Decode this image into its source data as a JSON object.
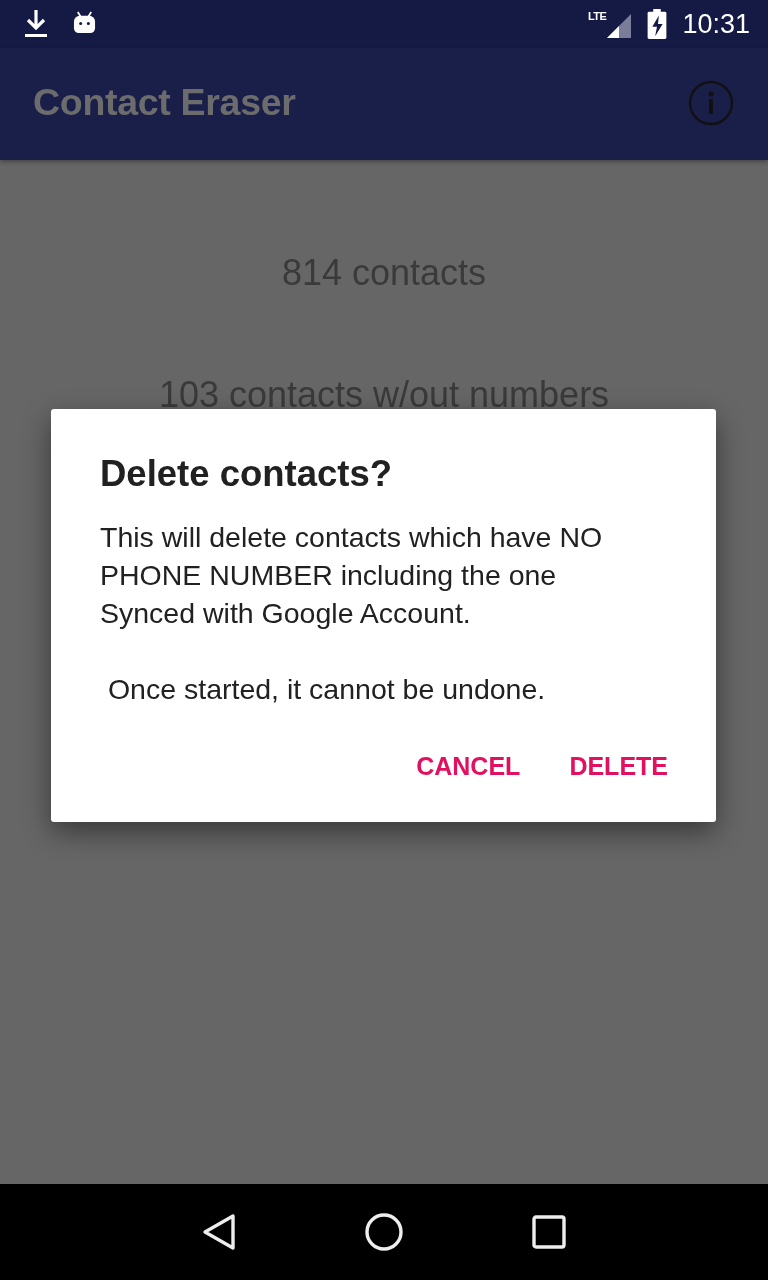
{
  "status_bar": {
    "network_type": "LTE",
    "charging": true,
    "time": "10:31"
  },
  "app_bar": {
    "title": "Contact Eraser"
  },
  "stats": [
    "814 contacts",
    "103 contacts w/out numbers"
  ],
  "dialog": {
    "title": "Delete contacts?",
    "message": "This will delete contacts which have NO PHONE NUMBER including the one Synced with Google Account.",
    "warning": " Once started, it cannot be undone.",
    "buttons": [
      {
        "label": "CANCEL"
      },
      {
        "label": "DELETE"
      }
    ]
  }
}
